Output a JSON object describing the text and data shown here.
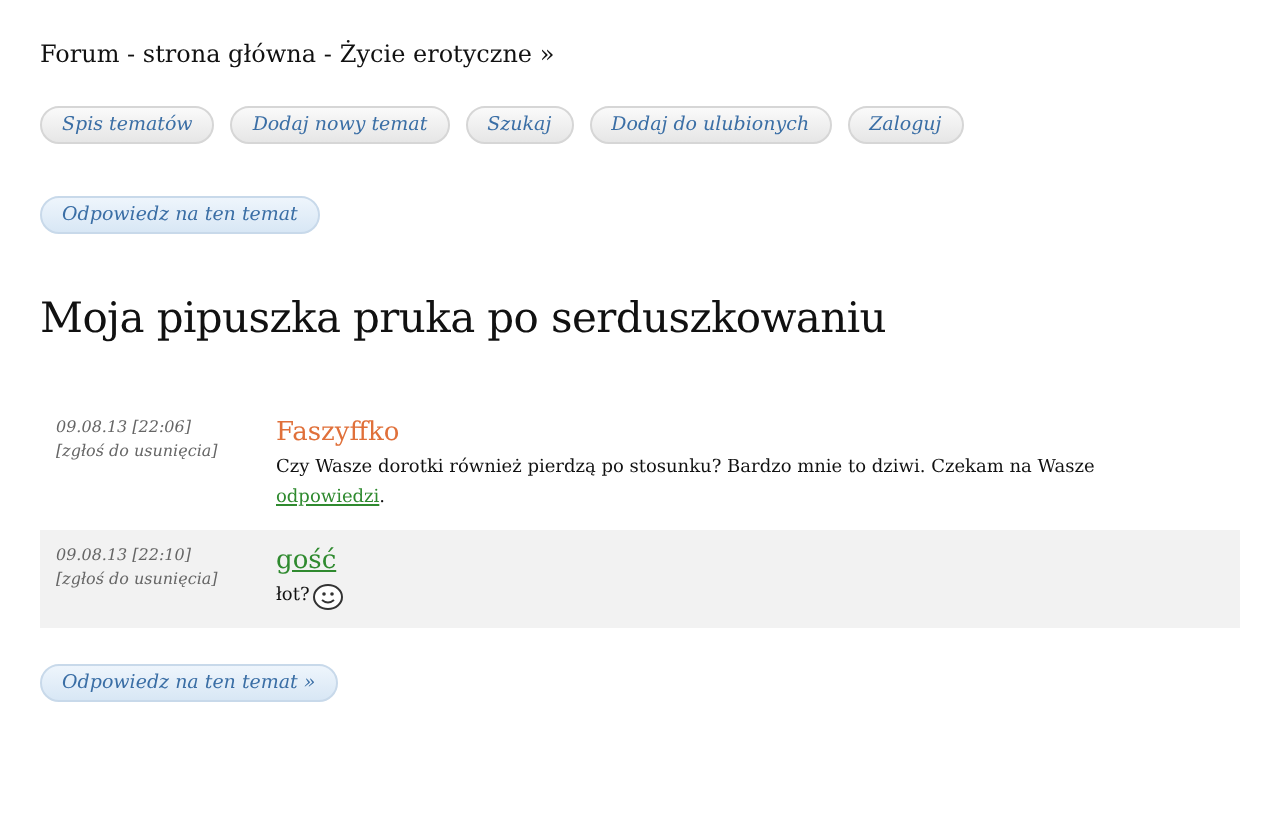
{
  "breadcrumb": [
    {
      "label": "Forum - strona główna -"
    },
    {
      "label": "Życie erotyczne »"
    }
  ],
  "nav_buttons": [
    "Spis tematów",
    "Dodaj nowy temat",
    "Szukaj",
    "Dodaj do ulubionych",
    "Zaloguj"
  ],
  "reply_button_top": "Odpowiedz na ten temat",
  "topic_title": "Moja pipuszka pruka po serduszkowaniu",
  "posts": [
    {
      "date": "09.08.13 [22:06]",
      "report": "[zgłoś do usunięcia]",
      "author": "Faszyffko",
      "guest": false,
      "body": [
        {
          "kind": "text",
          "text": "Czy Wasze dorotki również pierdzą po stosunku? Bardzo mnie to dziwi. Czekam na Wasze "
        },
        {
          "kind": "link",
          "text": "odpowiedzi"
        },
        {
          "kind": "text",
          "text": "."
        }
      ],
      "smiley": false
    },
    {
      "date": "09.08.13 [22:10]",
      "report": "[zgłoś do usunięcia]",
      "author": "gość",
      "guest": true,
      "body": [
        {
          "kind": "text",
          "text": "łot?"
        }
      ],
      "smiley": true
    }
  ],
  "reply_button_bottom": "Odpowiedz na ten temat »"
}
